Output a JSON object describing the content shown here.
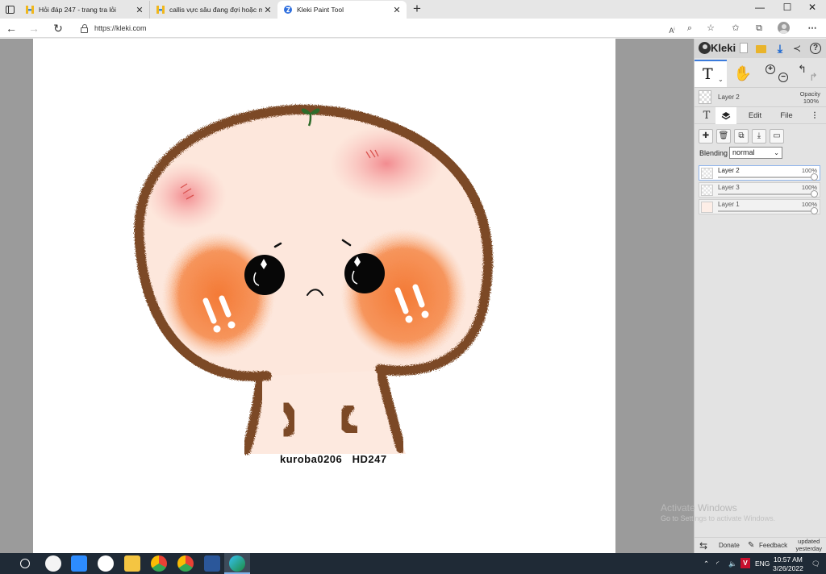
{
  "browser": {
    "tabs": [
      {
        "title": "Hỏi đáp 247 - trang tra lỏi",
        "active": false
      },
      {
        "title": "callis vực sâu đang đợi hoặc mãn",
        "active": false
      },
      {
        "title": "Kleki Paint Tool",
        "active": true
      }
    ],
    "url": "https://kleki.com",
    "window_controls": {
      "minimize": "—",
      "maximize": "☐",
      "close": "✕"
    }
  },
  "canvas": {
    "watermark": "kuroba0206   HD247",
    "colors": {
      "outline": "#7b4a27",
      "face": "#fde7dc",
      "blush": "#f48c4e",
      "pink": "#f2868a",
      "sprout": "#2e6b2a"
    }
  },
  "app": {
    "name": "Kleki",
    "accent": "#3b7bdc",
    "header_icons": [
      "new-image-icon",
      "open-folder-icon",
      "download-icon",
      "share-icon",
      "help-icon"
    ],
    "help_label": "?",
    "active_tool": "T",
    "current_layer": {
      "name": "Layer 2",
      "opacity_label": "Opacity",
      "opacity_value": "100%"
    },
    "panel_tabs": {
      "text": "T",
      "layers": "layers-icon",
      "edit": "Edit",
      "file": "File",
      "more": "⋮"
    },
    "blending": {
      "label": "Blending",
      "value": "normal"
    },
    "layers": [
      {
        "name": "Layer 2",
        "opacity": "100%",
        "selected": true
      },
      {
        "name": "Layer 3",
        "opacity": "100%",
        "selected": false
      },
      {
        "name": "Layer 1",
        "opacity": "100%",
        "selected": false
      }
    ],
    "footer": {
      "donate": "Donate",
      "feedback": "Feedback",
      "updated_line1": "updated",
      "updated_line2": "yesterday"
    }
  },
  "os": {
    "activate_title": "Activate Windows",
    "activate_sub": "Go to Settings to activate Windows.",
    "language": "ENG",
    "time": "10:57 AM",
    "date": "3/26/2022"
  }
}
